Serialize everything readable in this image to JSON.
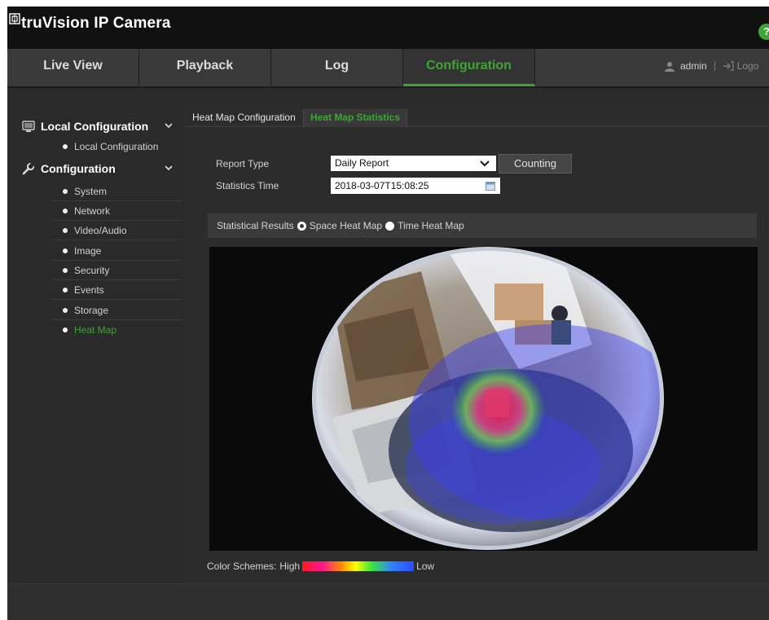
{
  "app": {
    "title": "truVision IP Camera"
  },
  "nav": {
    "tabs": [
      {
        "label": "Live View"
      },
      {
        "label": "Playback"
      },
      {
        "label": "Log"
      },
      {
        "label": "Configuration"
      }
    ],
    "user": "admin",
    "logout": "Logo"
  },
  "sidebar": {
    "sections": [
      {
        "label": "Local Configuration",
        "items": [
          {
            "label": "Local Configuration"
          }
        ]
      },
      {
        "label": "Configuration",
        "items": [
          {
            "label": "System"
          },
          {
            "label": "Network"
          },
          {
            "label": "Video/Audio"
          },
          {
            "label": "Image"
          },
          {
            "label": "Security"
          },
          {
            "label": "Events"
          },
          {
            "label": "Storage"
          },
          {
            "label": "Heat Map"
          }
        ]
      }
    ],
    "active_item": "Heat Map"
  },
  "subtabs": [
    {
      "label": "Heat Map Configuration"
    },
    {
      "label": "Heat Map Statistics"
    }
  ],
  "form": {
    "report_type_label": "Report Type",
    "report_type_value": "Daily Report",
    "counting_button": "Counting",
    "statistics_time_label": "Statistics Time",
    "statistics_time_value": "2018-03-07T15:08:25"
  },
  "results": {
    "label": "Statistical Results",
    "options": [
      {
        "label": "Space Heat Map",
        "selected": true
      },
      {
        "label": "Time Heat Map",
        "selected": false
      }
    ]
  },
  "color_scheme": {
    "label": "Color Schemes:",
    "high": "High",
    "low": "Low"
  },
  "colors": {
    "accent": "#3ea535",
    "background": "#2b2b2b",
    "topbar": "#111111"
  }
}
